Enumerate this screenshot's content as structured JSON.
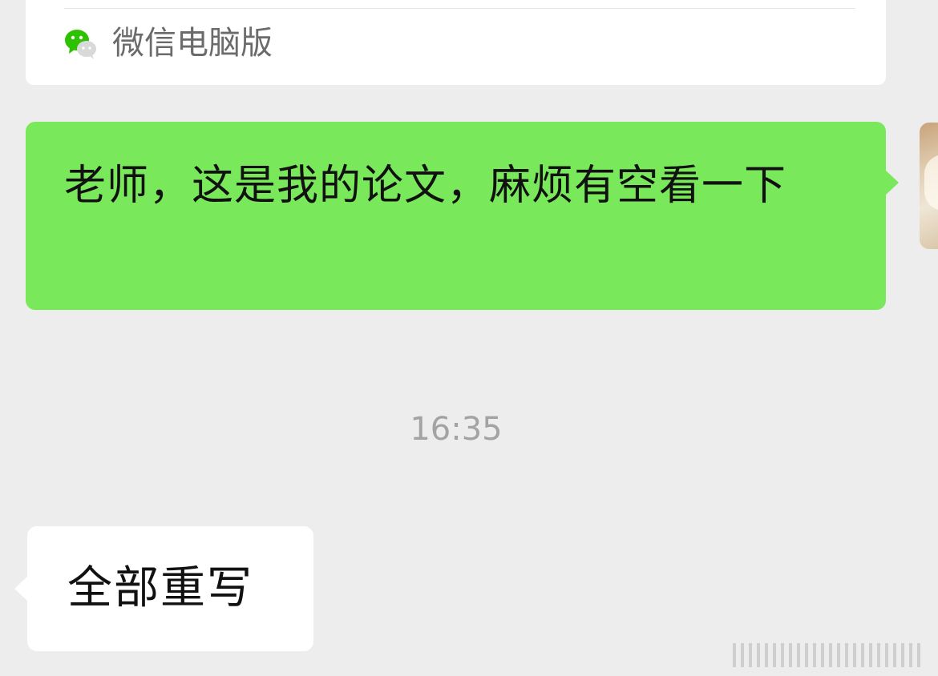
{
  "card": {
    "source_label": "微信电脑版",
    "icon": "wechat-icon"
  },
  "messages": [
    {
      "direction": "sent",
      "text": "老师，这是我的论文，麻烦有空看一下"
    },
    {
      "direction": "received",
      "text": "全部重写"
    }
  ],
  "timestamp": "16:35",
  "colors": {
    "sent_bubble": "#79e85b",
    "received_bubble": "#ffffff",
    "background": "#ededed",
    "timestamp": "#a3a3a3",
    "wechat_green": "#2dc100"
  }
}
